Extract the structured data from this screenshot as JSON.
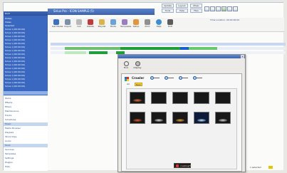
{
  "window": {
    "title": "Sirius Pro - ICON SAMPLE (5)"
  },
  "top_buttons": [
    "Update",
    "Layout",
    "Mixer",
    "Tools",
    "Help",
    "Files"
  ],
  "sidebar": {
    "section_label": "Root",
    "items": [
      "Hilites",
      "Views",
      "Selected",
      "Sirius 1 (00:00:00)",
      "Sirius 1 (00:00:00)",
      "Sirius 1 (00:00:00)",
      "Sirius 1 (00:00:00)",
      "Sirius 1 (00:00:00)",
      "Sirius 1 (00:00:00)",
      "Sirius 1 (00:00:00)",
      "Sirius 1 (00:00:00)",
      "Sirius 1 (00:00:00)",
      "Sirius 1 (00:00:00)",
      "Sirius 1 (00:00:00)",
      "Sirius 1 (00:00:00)",
      "Sirius 1 (00:00:00)",
      "Sirius 1 (00:00:00)",
      "Sirius 1 (00:00:00)",
      "Sirius 1 (00:00:00)",
      "Sirius 1 (00:00:00)"
    ],
    "sub_items": [
      "Items",
      "Effects",
      "Filters",
      "Maintenance",
      "Tracks",
      "Schedules",
      "Music",
      "Media Browser",
      "Playlists",
      "Stock Clips",
      "Audio",
      "Tools",
      "Services",
      "Templates",
      "Settings",
      "Plugins",
      "Help"
    ]
  },
  "toolbar": {
    "buttons": [
      "Get Media",
      "Import",
      "Cut",
      "Delete",
      "Playlist",
      "Mode",
      "Templates",
      "Setup",
      "Print",
      "Help",
      "Exit"
    ],
    "right_text": "Time Location: 00:00:00:00"
  },
  "dialog": {
    "tools": [
      "Find",
      "Display"
    ],
    "brand": "Crawler",
    "nav": [
      "Back",
      "Next",
      "Prev",
      "Last"
    ],
    "subtabs": [
      "All",
      "New"
    ],
    "footer_logo": "creatingFX"
  },
  "status": {
    "text": "1 selected"
  },
  "colors": {
    "accent": "#3a68c0",
    "tab_active": "#f4d03f",
    "timeline_green": "#1f9e3a",
    "timeline_blue": "#1c5fd0"
  }
}
